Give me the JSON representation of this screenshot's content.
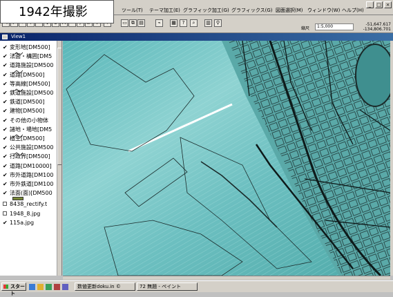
{
  "caption": "1942年撮影",
  "menu": [
    "ツール(T)",
    "テーマ加工(E)",
    "グラフィック加工(G)",
    "グラフィックス(G)",
    "図面選択(M)",
    "ウィンドウ(W)",
    "ヘルプ(H)"
  ],
  "scale": {
    "label": "縮尺",
    "value": "1:5,000"
  },
  "coords": {
    "x": "-51,647.617",
    "y": "-134,806.701"
  },
  "view": {
    "title": "View1"
  },
  "toc": [
    {
      "label": "変形地[DM500]",
      "checked": true,
      "symbol": "line"
    },
    {
      "label": "法面・構囲[DM5",
      "checked": true,
      "symbol": "none"
    },
    {
      "label": "道路施設[DM500",
      "checked": true,
      "symbol": "line"
    },
    {
      "label": "道路[DM500]",
      "checked": true,
      "symbol": "none"
    },
    {
      "label": "等高線[DM500]",
      "checked": true,
      "symbol": "line"
    },
    {
      "label": "鉄道施設[DM500",
      "checked": true,
      "symbol": "none"
    },
    {
      "label": "鉄道[DM500]",
      "checked": true,
      "symbol": "none"
    },
    {
      "label": "建物[DM500]",
      "checked": true,
      "symbol": "none"
    },
    {
      "label": "その他の小物体",
      "checked": true,
      "symbol": "none"
    },
    {
      "label": "諸地・場地[DM5",
      "checked": true,
      "symbol": "line"
    },
    {
      "label": "植生[DM500]",
      "checked": true,
      "symbol": "none"
    },
    {
      "label": "公共施設[DM500",
      "checked": true,
      "symbol": "line"
    },
    {
      "label": "行政界[DM500]",
      "checked": true,
      "symbol": "none"
    },
    {
      "label": "道路[DM10000]",
      "checked": true,
      "symbol": "none"
    },
    {
      "label": "市外道路[DM100",
      "checked": true,
      "symbol": "none"
    },
    {
      "label": "市外鉄道[DM100",
      "checked": true,
      "symbol": "none"
    },
    {
      "label": "法面(面)[DM500",
      "checked": true,
      "symbol": "fill"
    },
    {
      "label": "8438_rectify.t",
      "checked": false,
      "symbol": "none"
    },
    {
      "label": "1948_8.jpg",
      "checked": false,
      "symbol": "none"
    },
    {
      "label": "115a.jpg",
      "checked": true,
      "symbol": "none"
    }
  ],
  "taskbar": {
    "start": "スタート",
    "tasks": [
      "数値更新doku.in ©",
      "72 無題 - ペイント"
    ]
  },
  "colors": {
    "photo": "#7fc9c9",
    "vector": "#1a2a2a",
    "accent": "#0a246a"
  }
}
